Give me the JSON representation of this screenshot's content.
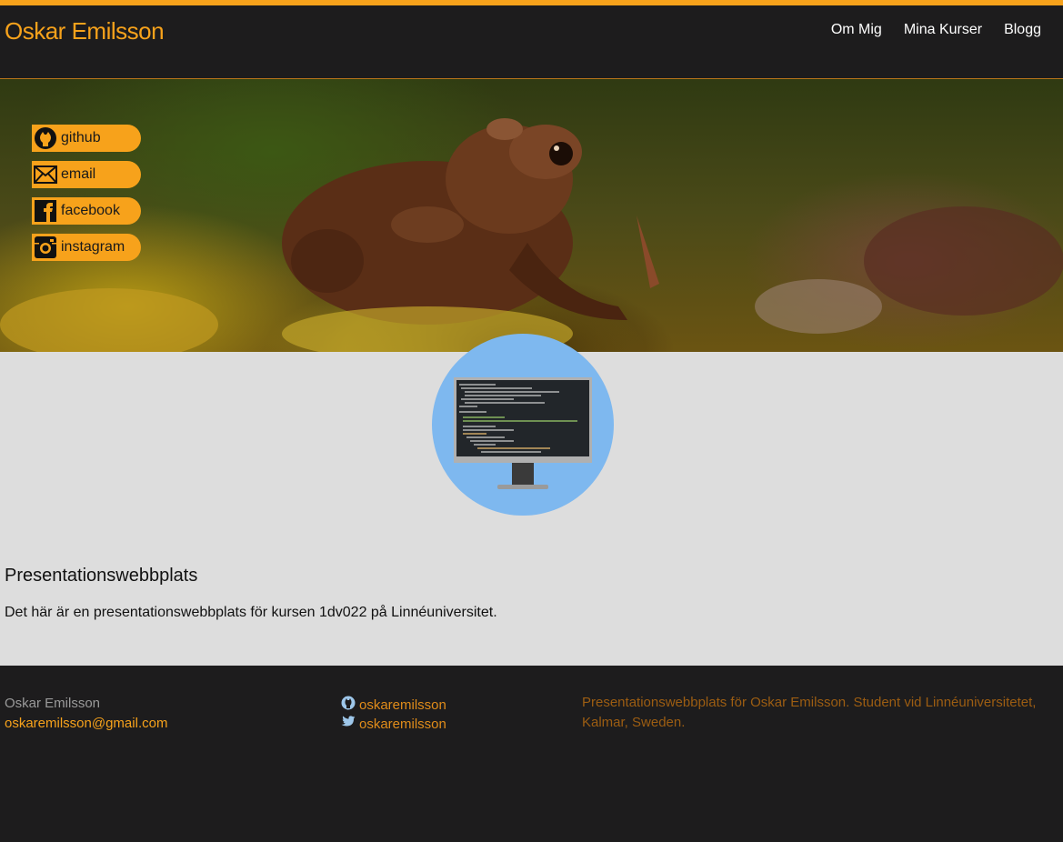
{
  "header": {
    "site_title": "Oskar Emilsson",
    "nav": [
      "Om Mig",
      "Mina Kurser",
      "Blogg"
    ]
  },
  "social": [
    {
      "label": "github",
      "icon": "github-icon"
    },
    {
      "label": "email",
      "icon": "envelope-icon"
    },
    {
      "label": "facebook",
      "icon": "facebook-icon"
    },
    {
      "label": "instagram",
      "icon": "instagram-icon"
    }
  ],
  "main": {
    "title": "Presentationswebbplats",
    "text": "Det här är en presentationswebbplats för kursen 1dv022 på Linnéuniversitet."
  },
  "footer": {
    "name": "Oskar Emilsson",
    "email": "oskaremilsson@gmail.com",
    "github_user": "oskaremilsson",
    "twitter_user": "oskaremilsson",
    "description": "Presentationswebbplats för Oskar Emilsson. Student vid Linnéuniversitetet, Kalmar, Sweden."
  },
  "colors": {
    "accent": "#f7a21b",
    "background_dark": "#1d1c1d",
    "content_background": "#dddddd",
    "avatar_background": "#7eb8ef"
  }
}
